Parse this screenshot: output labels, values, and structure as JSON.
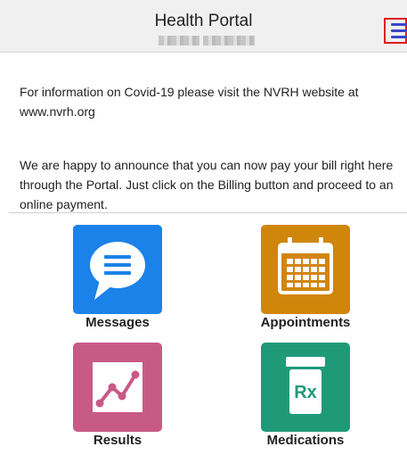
{
  "header": {
    "title": "Health Portal",
    "subtitle_note": ""
  },
  "notices": [
    "For information on Covid-19 please visit the NVRH website at www.nvrh.org",
    "We are happy to announce that you can now pay your bill right here through the Portal. Just click on the Billing button and proceed to an online payment."
  ],
  "tiles": [
    {
      "label": "Messages",
      "icon": "chat-bubble-icon",
      "color": "#1a82e8"
    },
    {
      "label": "Appointments",
      "icon": "calendar-icon",
      "color": "#d0860a"
    },
    {
      "label": "Results",
      "icon": "trend-chart-icon",
      "color": "#c85a86"
    },
    {
      "label": "Medications",
      "icon": "rx-bottle-icon",
      "color": "#1f9a79"
    }
  ],
  "colors": {
    "header_bg": "#f0f0f0",
    "menu_icon": "#3b46c8",
    "menu_highlight": "#e01b1b"
  }
}
